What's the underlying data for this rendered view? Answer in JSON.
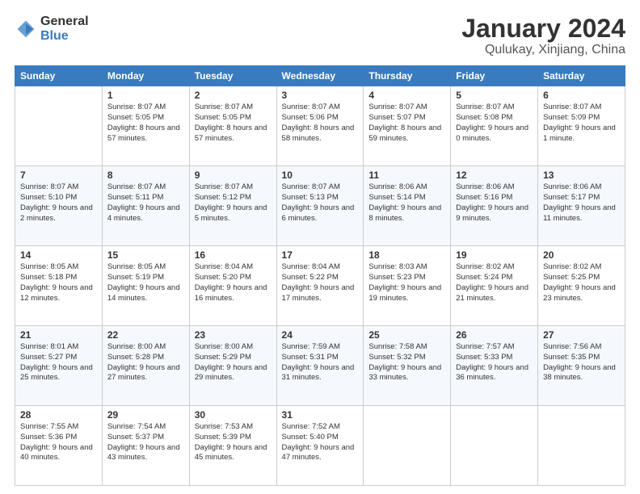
{
  "logo": {
    "general": "General",
    "blue": "Blue"
  },
  "title": "January 2024",
  "location": "Qulukay, Xinjiang, China",
  "weekdays": [
    "Sunday",
    "Monday",
    "Tuesday",
    "Wednesday",
    "Thursday",
    "Friday",
    "Saturday"
  ],
  "weeks": [
    [
      {
        "day": "",
        "sunrise": "",
        "sunset": "",
        "daylight": ""
      },
      {
        "day": "1",
        "sunrise": "Sunrise: 8:07 AM",
        "sunset": "Sunset: 5:05 PM",
        "daylight": "Daylight: 8 hours and 57 minutes."
      },
      {
        "day": "2",
        "sunrise": "Sunrise: 8:07 AM",
        "sunset": "Sunset: 5:05 PM",
        "daylight": "Daylight: 8 hours and 57 minutes."
      },
      {
        "day": "3",
        "sunrise": "Sunrise: 8:07 AM",
        "sunset": "Sunset: 5:06 PM",
        "daylight": "Daylight: 8 hours and 58 minutes."
      },
      {
        "day": "4",
        "sunrise": "Sunrise: 8:07 AM",
        "sunset": "Sunset: 5:07 PM",
        "daylight": "Daylight: 8 hours and 59 minutes."
      },
      {
        "day": "5",
        "sunrise": "Sunrise: 8:07 AM",
        "sunset": "Sunset: 5:08 PM",
        "daylight": "Daylight: 9 hours and 0 minutes."
      },
      {
        "day": "6",
        "sunrise": "Sunrise: 8:07 AM",
        "sunset": "Sunset: 5:09 PM",
        "daylight": "Daylight: 9 hours and 1 minute."
      }
    ],
    [
      {
        "day": "7",
        "sunrise": "Sunrise: 8:07 AM",
        "sunset": "Sunset: 5:10 PM",
        "daylight": "Daylight: 9 hours and 2 minutes."
      },
      {
        "day": "8",
        "sunrise": "Sunrise: 8:07 AM",
        "sunset": "Sunset: 5:11 PM",
        "daylight": "Daylight: 9 hours and 4 minutes."
      },
      {
        "day": "9",
        "sunrise": "Sunrise: 8:07 AM",
        "sunset": "Sunset: 5:12 PM",
        "daylight": "Daylight: 9 hours and 5 minutes."
      },
      {
        "day": "10",
        "sunrise": "Sunrise: 8:07 AM",
        "sunset": "Sunset: 5:13 PM",
        "daylight": "Daylight: 9 hours and 6 minutes."
      },
      {
        "day": "11",
        "sunrise": "Sunrise: 8:06 AM",
        "sunset": "Sunset: 5:14 PM",
        "daylight": "Daylight: 9 hours and 8 minutes."
      },
      {
        "day": "12",
        "sunrise": "Sunrise: 8:06 AM",
        "sunset": "Sunset: 5:16 PM",
        "daylight": "Daylight: 9 hours and 9 minutes."
      },
      {
        "day": "13",
        "sunrise": "Sunrise: 8:06 AM",
        "sunset": "Sunset: 5:17 PM",
        "daylight": "Daylight: 9 hours and 11 minutes."
      }
    ],
    [
      {
        "day": "14",
        "sunrise": "Sunrise: 8:05 AM",
        "sunset": "Sunset: 5:18 PM",
        "daylight": "Daylight: 9 hours and 12 minutes."
      },
      {
        "day": "15",
        "sunrise": "Sunrise: 8:05 AM",
        "sunset": "Sunset: 5:19 PM",
        "daylight": "Daylight: 9 hours and 14 minutes."
      },
      {
        "day": "16",
        "sunrise": "Sunrise: 8:04 AM",
        "sunset": "Sunset: 5:20 PM",
        "daylight": "Daylight: 9 hours and 16 minutes."
      },
      {
        "day": "17",
        "sunrise": "Sunrise: 8:04 AM",
        "sunset": "Sunset: 5:22 PM",
        "daylight": "Daylight: 9 hours and 17 minutes."
      },
      {
        "day": "18",
        "sunrise": "Sunrise: 8:03 AM",
        "sunset": "Sunset: 5:23 PM",
        "daylight": "Daylight: 9 hours and 19 minutes."
      },
      {
        "day": "19",
        "sunrise": "Sunrise: 8:02 AM",
        "sunset": "Sunset: 5:24 PM",
        "daylight": "Daylight: 9 hours and 21 minutes."
      },
      {
        "day": "20",
        "sunrise": "Sunrise: 8:02 AM",
        "sunset": "Sunset: 5:25 PM",
        "daylight": "Daylight: 9 hours and 23 minutes."
      }
    ],
    [
      {
        "day": "21",
        "sunrise": "Sunrise: 8:01 AM",
        "sunset": "Sunset: 5:27 PM",
        "daylight": "Daylight: 9 hours and 25 minutes."
      },
      {
        "day": "22",
        "sunrise": "Sunrise: 8:00 AM",
        "sunset": "Sunset: 5:28 PM",
        "daylight": "Daylight: 9 hours and 27 minutes."
      },
      {
        "day": "23",
        "sunrise": "Sunrise: 8:00 AM",
        "sunset": "Sunset: 5:29 PM",
        "daylight": "Daylight: 9 hours and 29 minutes."
      },
      {
        "day": "24",
        "sunrise": "Sunrise: 7:59 AM",
        "sunset": "Sunset: 5:31 PM",
        "daylight": "Daylight: 9 hours and 31 minutes."
      },
      {
        "day": "25",
        "sunrise": "Sunrise: 7:58 AM",
        "sunset": "Sunset: 5:32 PM",
        "daylight": "Daylight: 9 hours and 33 minutes."
      },
      {
        "day": "26",
        "sunrise": "Sunrise: 7:57 AM",
        "sunset": "Sunset: 5:33 PM",
        "daylight": "Daylight: 9 hours and 36 minutes."
      },
      {
        "day": "27",
        "sunrise": "Sunrise: 7:56 AM",
        "sunset": "Sunset: 5:35 PM",
        "daylight": "Daylight: 9 hours and 38 minutes."
      }
    ],
    [
      {
        "day": "28",
        "sunrise": "Sunrise: 7:55 AM",
        "sunset": "Sunset: 5:36 PM",
        "daylight": "Daylight: 9 hours and 40 minutes."
      },
      {
        "day": "29",
        "sunrise": "Sunrise: 7:54 AM",
        "sunset": "Sunset: 5:37 PM",
        "daylight": "Daylight: 9 hours and 43 minutes."
      },
      {
        "day": "30",
        "sunrise": "Sunrise: 7:53 AM",
        "sunset": "Sunset: 5:39 PM",
        "daylight": "Daylight: 9 hours and 45 minutes."
      },
      {
        "day": "31",
        "sunrise": "Sunrise: 7:52 AM",
        "sunset": "Sunset: 5:40 PM",
        "daylight": "Daylight: 9 hours and 47 minutes."
      },
      {
        "day": "",
        "sunrise": "",
        "sunset": "",
        "daylight": ""
      },
      {
        "day": "",
        "sunrise": "",
        "sunset": "",
        "daylight": ""
      },
      {
        "day": "",
        "sunrise": "",
        "sunset": "",
        "daylight": ""
      }
    ]
  ]
}
